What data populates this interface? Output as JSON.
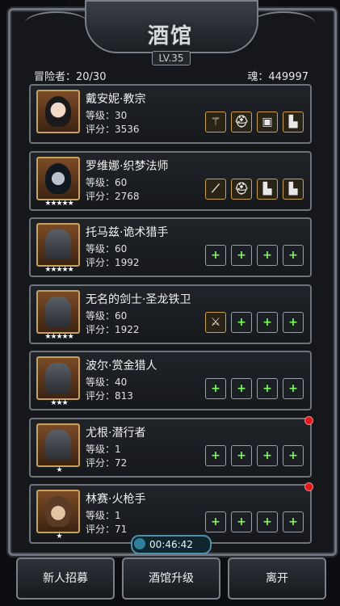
{
  "header": {
    "title": "酒馆",
    "level": "LV.35"
  },
  "stats": {
    "adventurers_label": "冒险者：20/30",
    "souls_label": "魂：449997"
  },
  "heroes": [
    {
      "name": "戴安妮·教宗",
      "level": "等级：30",
      "score": "评分：3536",
      "stars": "",
      "portrait": "priestess",
      "slots": [
        "staff",
        "helmet",
        "tome",
        "boots"
      ],
      "new": false
    },
    {
      "name": "罗维娜·织梦法师",
      "level": "等级：60",
      "score": "评分：2768",
      "stars": "★★★★★",
      "portrait": "mage",
      "slots": [
        "wand",
        "helmet",
        "boots",
        "boots"
      ],
      "new": false
    },
    {
      "name": "托马兹·诡术猎手",
      "level": "等级：60",
      "score": "评分：1992",
      "stars": "★★★★★",
      "portrait": "knight",
      "slots": [
        "plus",
        "plus",
        "plus",
        "plus"
      ],
      "new": false
    },
    {
      "name": "无名的剑士·圣龙铁卫",
      "level": "等级：60",
      "score": "评分：1922",
      "stars": "★★★★★",
      "portrait": "knight",
      "slots": [
        "sword",
        "plus",
        "plus",
        "plus"
      ],
      "new": false
    },
    {
      "name": "波尔·赏金猎人",
      "level": "等级：40",
      "score": "评分：813",
      "stars": "★★★",
      "portrait": "knight",
      "slots": [
        "plus",
        "plus",
        "plus",
        "plus"
      ],
      "new": false
    },
    {
      "name": "尤根·潜行者",
      "level": "等级：1",
      "score": "评分：72",
      "stars": "★",
      "portrait": "knight",
      "slots": [
        "plus",
        "plus",
        "plus",
        "plus"
      ],
      "new": true
    },
    {
      "name": "林赛·火枪手",
      "level": "等级：1",
      "score": "评分：71",
      "stars": "★",
      "portrait": "gunner",
      "slots": [
        "plus",
        "plus",
        "plus",
        "plus"
      ],
      "new": true
    }
  ],
  "timer": "00:46:42",
  "buttons": {
    "recruit": "新人招募",
    "upgrade": "酒馆升级",
    "leave": "离开"
  },
  "colors": {
    "plus": "#7dff5a",
    "frame": "#6d737b",
    "portrait_border": "#c6a260",
    "new_dot": "#e01919"
  }
}
